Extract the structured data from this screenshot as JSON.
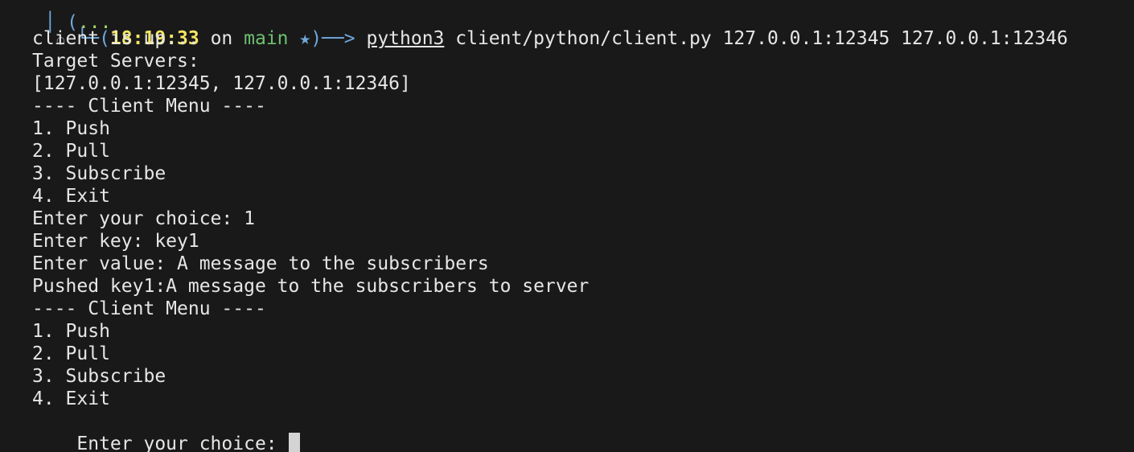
{
  "terminal": {
    "cut_top": {
      "prefix": "│ (",
      "path": "...",
      "middle": "",
      "tail": ""
    },
    "prompt": {
      "marker": "○",
      "corner": "└─",
      "open": "(",
      "time": "18:19:33",
      "on": " on ",
      "branch": "main",
      "star": " ★",
      "close": ")",
      "arrow": "──> ",
      "command": "python3",
      "args": " client/python/client.py 127.0.0.1:12345 127.0.0.1:12346"
    },
    "output": [
      "client is up...",
      "Target Servers:",
      "[127.0.0.1:12345, 127.0.0.1:12346]",
      "---- Client Menu ----",
      "1. Push",
      "2. Pull",
      "3. Subscribe",
      "4. Exit",
      "Enter your choice: 1",
      "Enter key: key1",
      "Enter value: A message to the subscribers",
      "Pushed key1:A message to the subscribers to server",
      "---- Client Menu ----",
      "1. Push",
      "2. Pull",
      "3. Subscribe",
      "4. Exit"
    ],
    "input_prompt": "Enter your choice: "
  }
}
